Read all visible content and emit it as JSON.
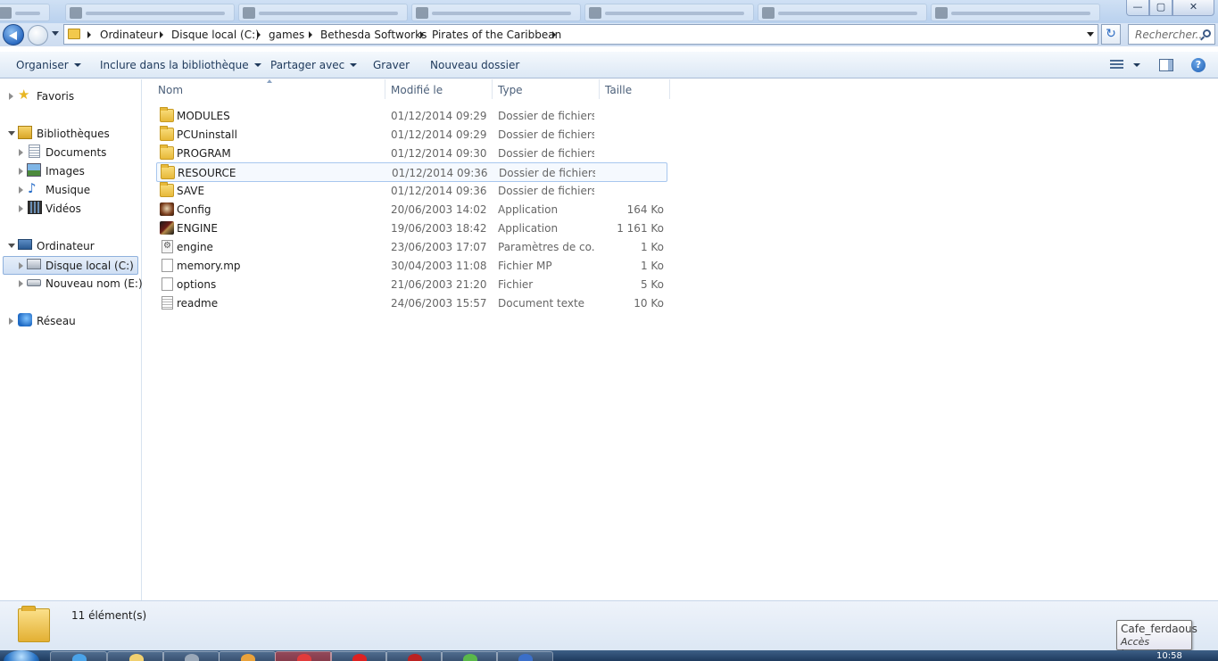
{
  "window": {
    "minimize_glyph": "—",
    "maximize_glyph": "▢",
    "close_glyph": "✕"
  },
  "address_bar": {
    "breadcrumbs": [
      "Ordinateur",
      "Disque local (C:)",
      "games",
      "Bethesda Softworks",
      "Pirates of the Caribbean"
    ],
    "refresh_glyph": "↻",
    "search_placeholder": "Rechercher..."
  },
  "command_bar": {
    "organize": "Organiser",
    "include_library": "Inclure dans la bibliothèque",
    "share_with": "Partager avec",
    "burn": "Graver",
    "new_folder": "Nouveau dossier",
    "help_glyph": "?"
  },
  "nav_pane": {
    "favorites": "Favoris",
    "libraries": "Bibliothèques",
    "documents": "Documents",
    "images": "Images",
    "music": "Musique",
    "videos": "Vidéos",
    "computer": "Ordinateur",
    "local_disk": "Disque local (C:)",
    "new_volume": "Nouveau nom (E:)",
    "network": "Réseau"
  },
  "columns": {
    "name": "Nom",
    "modified": "Modifié le",
    "type": "Type",
    "size": "Taille"
  },
  "files": [
    {
      "name": "MODULES",
      "modified": "01/12/2014 09:29",
      "type": "Dossier de fichiers",
      "size": "",
      "icon": "folder-icon"
    },
    {
      "name": "PCUninstall",
      "modified": "01/12/2014 09:29",
      "type": "Dossier de fichiers",
      "size": "",
      "icon": "folder-icon"
    },
    {
      "name": "PROGRAM",
      "modified": "01/12/2014 09:30",
      "type": "Dossier de fichiers",
      "size": "",
      "icon": "folder-icon"
    },
    {
      "name": "RESOURCE",
      "modified": "01/12/2014 09:36",
      "type": "Dossier de fichiers",
      "size": "",
      "icon": "folder-icon"
    },
    {
      "name": "SAVE",
      "modified": "01/12/2014 09:36",
      "type": "Dossier de fichiers",
      "size": "",
      "icon": "folder-icon"
    },
    {
      "name": "Config",
      "modified": "20/06/2003 14:02",
      "type": "Application",
      "size": "164 Ko",
      "icon": "config-app-icon"
    },
    {
      "name": "ENGINE",
      "modified": "19/06/2003 18:42",
      "type": "Application",
      "size": "1 161 Ko",
      "icon": "engine-app-icon"
    },
    {
      "name": "engine",
      "modified": "23/06/2003 17:07",
      "type": "Paramètres de co...",
      "size": "1 Ko",
      "icon": "settings-file-icon"
    },
    {
      "name": "memory.mp",
      "modified": "30/04/2003 11:08",
      "type": "Fichier MP",
      "size": "1 Ko",
      "icon": "blank-file-icon"
    },
    {
      "name": "options",
      "modified": "21/06/2003 21:20",
      "type": "Fichier",
      "size": "5 Ko",
      "icon": "blank-file-icon"
    },
    {
      "name": "readme",
      "modified": "24/06/2003 15:57",
      "type": "Document texte",
      "size": "10 Ko",
      "icon": "text-file-icon"
    }
  ],
  "details": {
    "item_count": "11 élément(s)"
  },
  "tooltip": {
    "line1": "Cafe_ferdaous",
    "line2": "Accès Internet"
  },
  "taskbar": {
    "clock": "10:58"
  }
}
